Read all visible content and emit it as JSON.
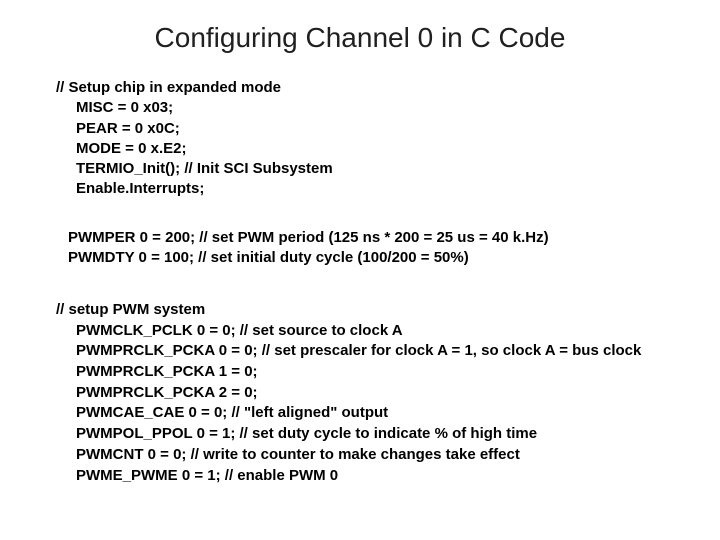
{
  "title": "Configuring Channel 0 in C Code",
  "block1": {
    "l1": "// Setup chip in expanded mode",
    "l2": "MISC = 0 x03;",
    "l3": "PEAR = 0 x0C;",
    "l4": "MODE = 0 x.E2;",
    "l5": "TERMIO_Init();  // Init SCI Subsystem",
    "l6": "Enable.Interrupts;"
  },
  "block2": {
    "l1": "PWMPER 0 = 200; // set PWM period (125 ns * 200 = 25 us = 40 k.Hz)",
    "l2": "PWMDTY 0 = 100;  // set initial duty cycle (100/200 = 50%)"
  },
  "block3": {
    "l1": "// setup PWM system",
    "l2": "PWMCLK_PCLK 0 = 0; // set source to clock A",
    "l3": "PWMPRCLK_PCKA 0 = 0; // set prescaler for clock A = 1, so clock A = bus clock",
    "l4": "PWMPRCLK_PCKA 1 = 0;",
    "l5": "PWMPRCLK_PCKA 2 = 0;",
    "l6": "PWMCAE_CAE 0 = 0;  // \"left aligned\" output",
    "l7": "PWMPOL_PPOL 0 = 1;    // set duty cycle to indicate % of high time",
    "l8": "PWMCNT 0 = 0; // write to counter to make changes take effect",
    "l9": "PWME_PWME 0 = 1;  // enable PWM 0"
  }
}
